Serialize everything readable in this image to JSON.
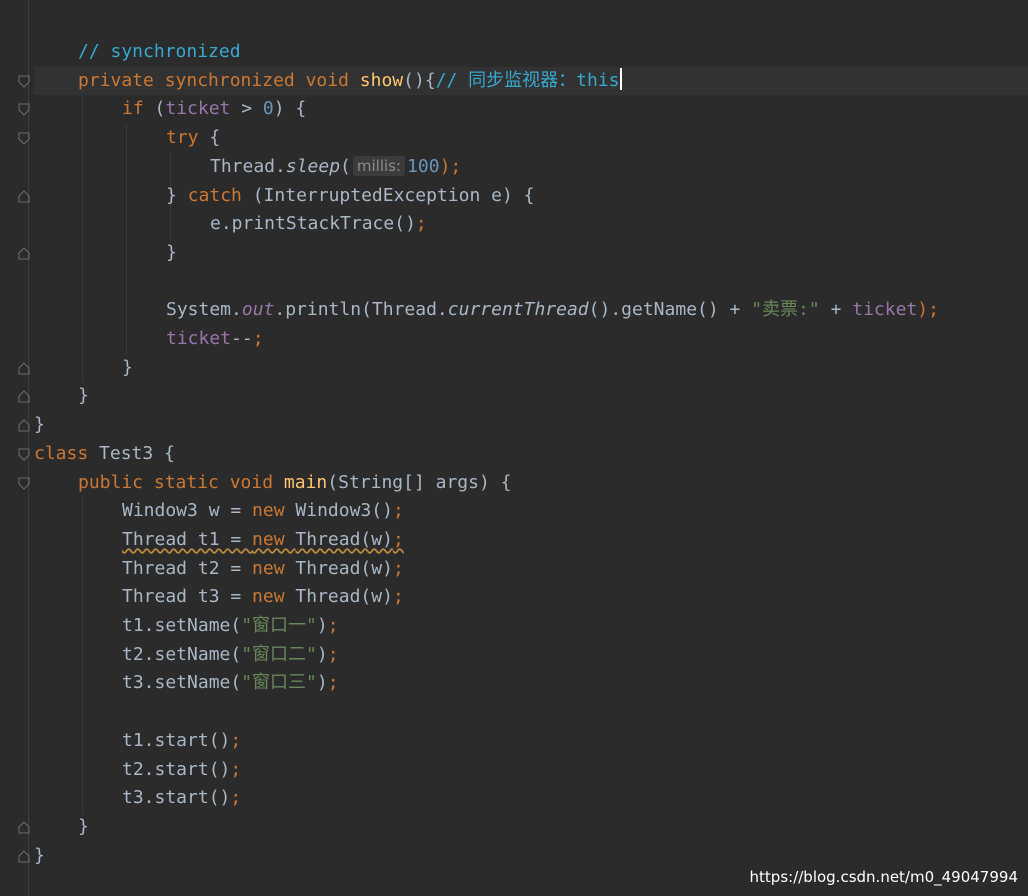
{
  "editor": {
    "lines": [
      {
        "indent": 1,
        "tokens": [
          {
            "t": "// synchronized",
            "c": "doc"
          }
        ]
      },
      {
        "indent": 1,
        "tokens": [
          {
            "t": "private ",
            "c": "kw"
          },
          {
            "t": "synchronized ",
            "c": "kw"
          },
          {
            "t": "void ",
            "c": "kw"
          },
          {
            "t": "show",
            "c": "fn"
          },
          {
            "t": "(){",
            "c": "plain"
          },
          {
            "t": "// 同步监视器：this",
            "c": "doc",
            "caret": true
          }
        ]
      },
      {
        "indent": 2,
        "tokens": [
          {
            "t": "if ",
            "c": "kw"
          },
          {
            "t": "(",
            "c": "plain"
          },
          {
            "t": "ticket",
            "c": "fld"
          },
          {
            "t": " > ",
            "c": "plain"
          },
          {
            "t": "0",
            "c": "num"
          },
          {
            "t": ") {",
            "c": "plain"
          }
        ]
      },
      {
        "indent": 3,
        "tokens": [
          {
            "t": "try ",
            "c": "kw"
          },
          {
            "t": "{",
            "c": "plain"
          }
        ]
      },
      {
        "indent": 4,
        "tokens": [
          {
            "t": "Thread.",
            "c": "plain"
          },
          {
            "t": "sleep",
            "c": "plain italic"
          },
          {
            "t": "(",
            "c": "plain"
          },
          {
            "t": "millis:",
            "c": "hint"
          },
          {
            "t": "100",
            "c": "num"
          },
          {
            "t": ");",
            "c": "kw"
          }
        ]
      },
      {
        "indent": 3,
        "tokens": [
          {
            "t": "} ",
            "c": "plain"
          },
          {
            "t": "catch ",
            "c": "kw"
          },
          {
            "t": "(InterruptedException e) {",
            "c": "plain"
          }
        ]
      },
      {
        "indent": 4,
        "tokens": [
          {
            "t": "e.printStackTrace()",
            "c": "plain"
          },
          {
            "t": ";",
            "c": "kw"
          }
        ]
      },
      {
        "indent": 3,
        "tokens": [
          {
            "t": "}",
            "c": "plain"
          }
        ]
      },
      {
        "indent": 0,
        "tokens": []
      },
      {
        "indent": 3,
        "tokens": [
          {
            "t": "System.",
            "c": "plain"
          },
          {
            "t": "out",
            "c": "fld italic"
          },
          {
            "t": ".println(Thread.",
            "c": "plain"
          },
          {
            "t": "currentThread",
            "c": "plain italic"
          },
          {
            "t": "().getName() + ",
            "c": "plain"
          },
          {
            "t": "\"卖票:\"",
            "c": "str"
          },
          {
            "t": " + ",
            "c": "plain"
          },
          {
            "t": "ticket",
            "c": "fld"
          },
          {
            "t": ");",
            "c": "kw"
          }
        ]
      },
      {
        "indent": 3,
        "tokens": [
          {
            "t": "ticket",
            "c": "fld"
          },
          {
            "t": "--",
            "c": "plain"
          },
          {
            "t": ";",
            "c": "kw"
          }
        ]
      },
      {
        "indent": 2,
        "tokens": [
          {
            "t": "}",
            "c": "plain"
          }
        ]
      },
      {
        "indent": 1,
        "tokens": [
          {
            "t": "}",
            "c": "plain"
          }
        ]
      },
      {
        "indent": 0,
        "tokens": [
          {
            "t": "}",
            "c": "plain"
          }
        ]
      },
      {
        "indent": 0,
        "tokens": [
          {
            "t": "class ",
            "c": "kw"
          },
          {
            "t": "Test3 {",
            "c": "plain"
          }
        ]
      },
      {
        "indent": 1,
        "tokens": [
          {
            "t": "public ",
            "c": "kw"
          },
          {
            "t": "static ",
            "c": "kw"
          },
          {
            "t": "void ",
            "c": "kw"
          },
          {
            "t": "main",
            "c": "fn"
          },
          {
            "t": "(String[] args) {",
            "c": "plain"
          }
        ]
      },
      {
        "indent": 2,
        "tokens": [
          {
            "t": "Window3 w = ",
            "c": "plain"
          },
          {
            "t": "new ",
            "c": "kw"
          },
          {
            "t": "Window3()",
            "c": "plain"
          },
          {
            "t": ";",
            "c": "kw"
          }
        ]
      },
      {
        "indent": 2,
        "tokens": [
          {
            "t": "Thread t1 = ",
            "c": "plain warn"
          },
          {
            "t": "new ",
            "c": "kw warn"
          },
          {
            "t": "Thread(w)",
            "c": "plain warn"
          },
          {
            "t": ";",
            "c": "kw warn"
          }
        ]
      },
      {
        "indent": 2,
        "tokens": [
          {
            "t": "Thread t2 = ",
            "c": "plain"
          },
          {
            "t": "new ",
            "c": "kw"
          },
          {
            "t": "Thread(w)",
            "c": "plain"
          },
          {
            "t": ";",
            "c": "kw"
          }
        ]
      },
      {
        "indent": 2,
        "tokens": [
          {
            "t": "Thread t3 = ",
            "c": "plain"
          },
          {
            "t": "new ",
            "c": "kw"
          },
          {
            "t": "Thread(w)",
            "c": "plain"
          },
          {
            "t": ";",
            "c": "kw"
          }
        ]
      },
      {
        "indent": 2,
        "tokens": [
          {
            "t": "t1.setName(",
            "c": "plain"
          },
          {
            "t": "\"窗口一\"",
            "c": "str"
          },
          {
            "t": ")",
            "c": "plain"
          },
          {
            "t": ";",
            "c": "kw"
          }
        ]
      },
      {
        "indent": 2,
        "tokens": [
          {
            "t": "t2.setName(",
            "c": "plain"
          },
          {
            "t": "\"窗口二\"",
            "c": "str"
          },
          {
            "t": ")",
            "c": "plain"
          },
          {
            "t": ";",
            "c": "kw"
          }
        ]
      },
      {
        "indent": 2,
        "tokens": [
          {
            "t": "t3.setName(",
            "c": "plain"
          },
          {
            "t": "\"窗口三\"",
            "c": "str"
          },
          {
            "t": ")",
            "c": "plain"
          },
          {
            "t": ";",
            "c": "kw"
          }
        ]
      },
      {
        "indent": 0,
        "tokens": []
      },
      {
        "indent": 2,
        "tokens": [
          {
            "t": "t1.start()",
            "c": "plain"
          },
          {
            "t": ";",
            "c": "kw"
          }
        ]
      },
      {
        "indent": 2,
        "tokens": [
          {
            "t": "t2.start()",
            "c": "plain"
          },
          {
            "t": ";",
            "c": "kw"
          }
        ]
      },
      {
        "indent": 2,
        "tokens": [
          {
            "t": "t3.start()",
            "c": "plain"
          },
          {
            "t": ";",
            "c": "kw"
          }
        ]
      },
      {
        "indent": 1,
        "tokens": [
          {
            "t": "}",
            "c": "plain"
          }
        ]
      },
      {
        "indent": 0,
        "tokens": [
          {
            "t": "}",
            "c": "plain"
          }
        ]
      }
    ],
    "fold_markers": [
      {
        "line": 1,
        "kind": "open"
      },
      {
        "line": 2,
        "kind": "open"
      },
      {
        "line": 3,
        "kind": "open"
      },
      {
        "line": 5,
        "kind": "close"
      },
      {
        "line": 7,
        "kind": "close"
      },
      {
        "line": 11,
        "kind": "close"
      },
      {
        "line": 12,
        "kind": "close"
      },
      {
        "line": 13,
        "kind": "close"
      },
      {
        "line": 14,
        "kind": "open"
      },
      {
        "line": 15,
        "kind": "open"
      },
      {
        "line": 27,
        "kind": "close"
      },
      {
        "line": 28,
        "kind": "close"
      }
    ]
  },
  "watermark": "https://blog.csdn.net/m0_49047994",
  "colors": {
    "background": "#2b2b2b",
    "keyword": "#cc7832",
    "method": "#ffc66d",
    "field": "#9876aa",
    "number": "#6897bb",
    "string": "#6a8759",
    "comment": "#37a9d1",
    "text": "#a9b7c6"
  }
}
